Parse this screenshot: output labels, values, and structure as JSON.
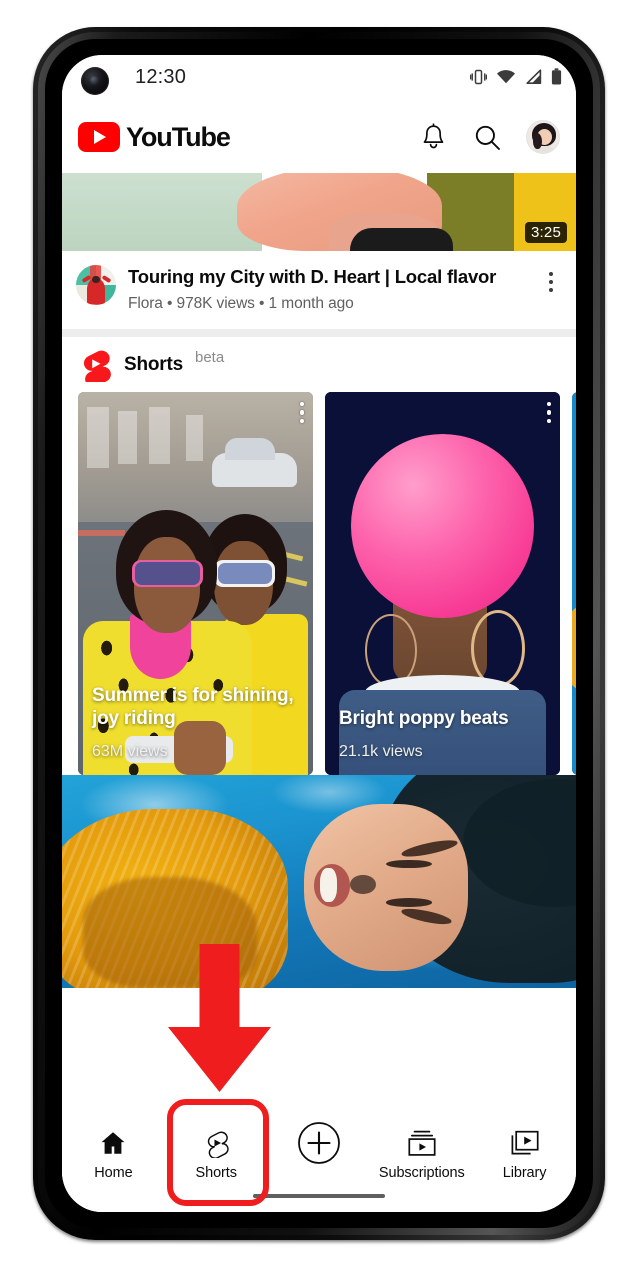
{
  "device": {
    "frame": "smartphone",
    "punch_hole_camera": "camera-icon"
  },
  "status_bar": {
    "time": "12:30",
    "icons": [
      "vibrate-icon",
      "wifi-icon",
      "cellular-signal-icon",
      "battery-icon"
    ]
  },
  "app_bar": {
    "logo_text": "YouTube",
    "logo_mark": "youtube-play-logo",
    "actions": [
      {
        "name": "notifications-bell-icon",
        "label": ""
      },
      {
        "name": "search-icon",
        "label": ""
      },
      {
        "name": "account-avatar",
        "label": ""
      }
    ]
  },
  "feed": {
    "video": {
      "duration": "3:25",
      "title": "Touring my City with D. Heart  | Local flavor",
      "meta": "Flora  •  978K views • 1 month ago",
      "channel": "Flora",
      "views": "978K views",
      "uploaded": "1 month ago",
      "menu_icon": "more-vertical-icon",
      "thumbnail_colors": [
        "#c5dcc8",
        "#f0a489",
        "#7c7e27",
        "#efc21a"
      ]
    },
    "shorts_shelf": {
      "logo": "shorts-logo",
      "title": "Shorts",
      "badge": "beta",
      "cards": [
        {
          "title": "Summer is for shining, joy riding",
          "views": "63M views",
          "menu_icon": "more-vertical-icon"
        },
        {
          "title": "Bright poppy beats",
          "views": "21.1k views",
          "menu_icon": "more-vertical-icon"
        },
        {
          "title": "",
          "views": "",
          "menu_icon": ""
        }
      ]
    },
    "next_video": {
      "thumbnail_description": "underwater-swimmer-thumbnail"
    }
  },
  "bottom_nav": {
    "items": [
      {
        "label": "Home",
        "icon": "home-icon"
      },
      {
        "label": "Shorts",
        "icon": "shorts-icon"
      },
      {
        "label": "",
        "icon": "create-plus-icon"
      },
      {
        "label": "Subscriptions",
        "icon": "subscriptions-icon"
      },
      {
        "label": "Library",
        "icon": "library-icon"
      }
    ],
    "home_indicator": "home-indicator-bar"
  },
  "annotations": {
    "arrow": {
      "name": "red-down-arrow",
      "color": "#ef1d1d",
      "points_to": "Shorts"
    },
    "highlight_box": {
      "name": "red-highlight-box",
      "color": "#ef1d1d",
      "around": "Shorts"
    }
  },
  "colors": {
    "brand_red": "#ff0000",
    "annotation_red": "#ef1d1d",
    "text_primary": "#0b0b0b",
    "text_secondary": "#606060"
  }
}
